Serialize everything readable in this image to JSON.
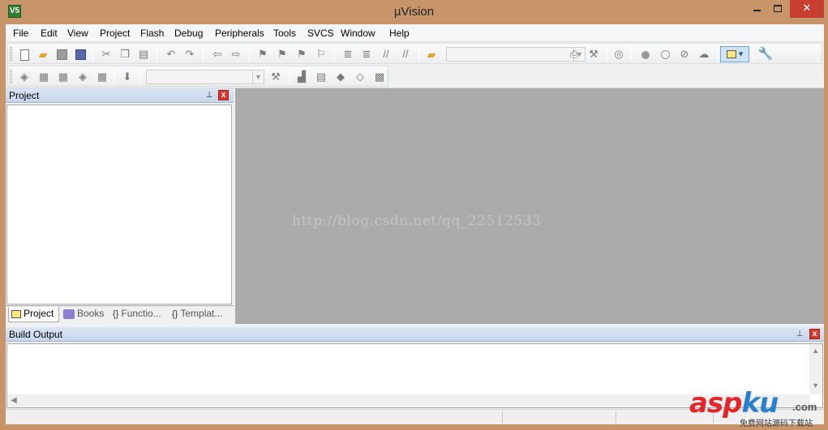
{
  "window": {
    "title": "µVision",
    "app_icon_glyph": "V5",
    "min_label": "",
    "max_label": "",
    "close_label": "✕"
  },
  "menu": {
    "items": [
      "File",
      "Edit",
      "View",
      "Project",
      "Flash",
      "Debug",
      "Peripherals",
      "Tools",
      "SVCS",
      "Window",
      "Help"
    ]
  },
  "toolbar": {
    "icons": [
      "new-file-icon",
      "open-folder-icon",
      "save-icon",
      "save-all-icon",
      "cut-icon",
      "copy-icon",
      "paste-icon",
      "undo-icon",
      "redo-icon",
      "navigate-back-icon",
      "navigate-forward-icon",
      "bookmark-icon",
      "indent-icon",
      "comment-icon",
      "find-icon",
      "breakpoint-icon",
      "config-wizard-icon",
      "wrench-icon"
    ],
    "target_select_value": ""
  },
  "panels": {
    "project": {
      "title": "Project",
      "pin": "⊥",
      "close": "x",
      "tabs": [
        {
          "label": "Project"
        },
        {
          "label": "Books"
        },
        {
          "label": "Functio..."
        },
        {
          "label": "Templat..."
        }
      ]
    },
    "build_output": {
      "title": "Build Output",
      "pin": "⊥",
      "close": "x"
    }
  },
  "editor": {
    "watermark": "http://blog.csdn.net/qq_22512533"
  },
  "site_logo": {
    "asp": "asp",
    "ku": "ku",
    "com": ".com",
    "sub": "免费网站源码下载站"
  },
  "colors": {
    "frame": "#c8956a",
    "editor_bg": "#ababab",
    "close_button": "#c7402f",
    "panel_header": "#c6d6ec"
  }
}
